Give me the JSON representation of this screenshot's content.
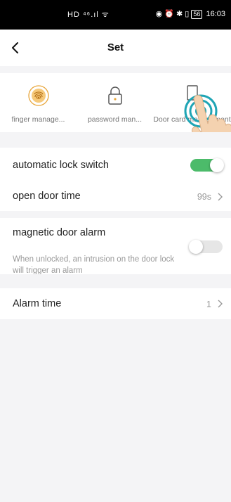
{
  "status": {
    "left_icons": "HD ⁴⁶.ıl ᯤ",
    "right_icons": "◉ ⏰ ✱ ▯",
    "battery": "56",
    "time": "16:03"
  },
  "header": {
    "title": "Set"
  },
  "management": [
    {
      "label": "finger manage...",
      "icon": "fingerprint-icon"
    },
    {
      "label": "password man...",
      "icon": "padlock-icon"
    },
    {
      "label": "Door card management",
      "icon": "door-card-icon"
    }
  ],
  "settings": {
    "auto_lock": {
      "label": "automatic lock switch",
      "on": true
    },
    "open_door_time": {
      "label": "open door time",
      "value": "99s"
    },
    "magnetic_alarm": {
      "label": "magnetic door alarm",
      "description": "When unlocked, an intrusion on the door lock will trigger an alarm",
      "on": false
    },
    "alarm_time": {
      "label": "Alarm time",
      "value": "1"
    }
  },
  "colors": {
    "accent_green": "#4cbb6a",
    "toggle_off": "#e6e6e6",
    "fingerprint_orange": "#e8a63a",
    "touch_teal": "#1fa5b5"
  }
}
